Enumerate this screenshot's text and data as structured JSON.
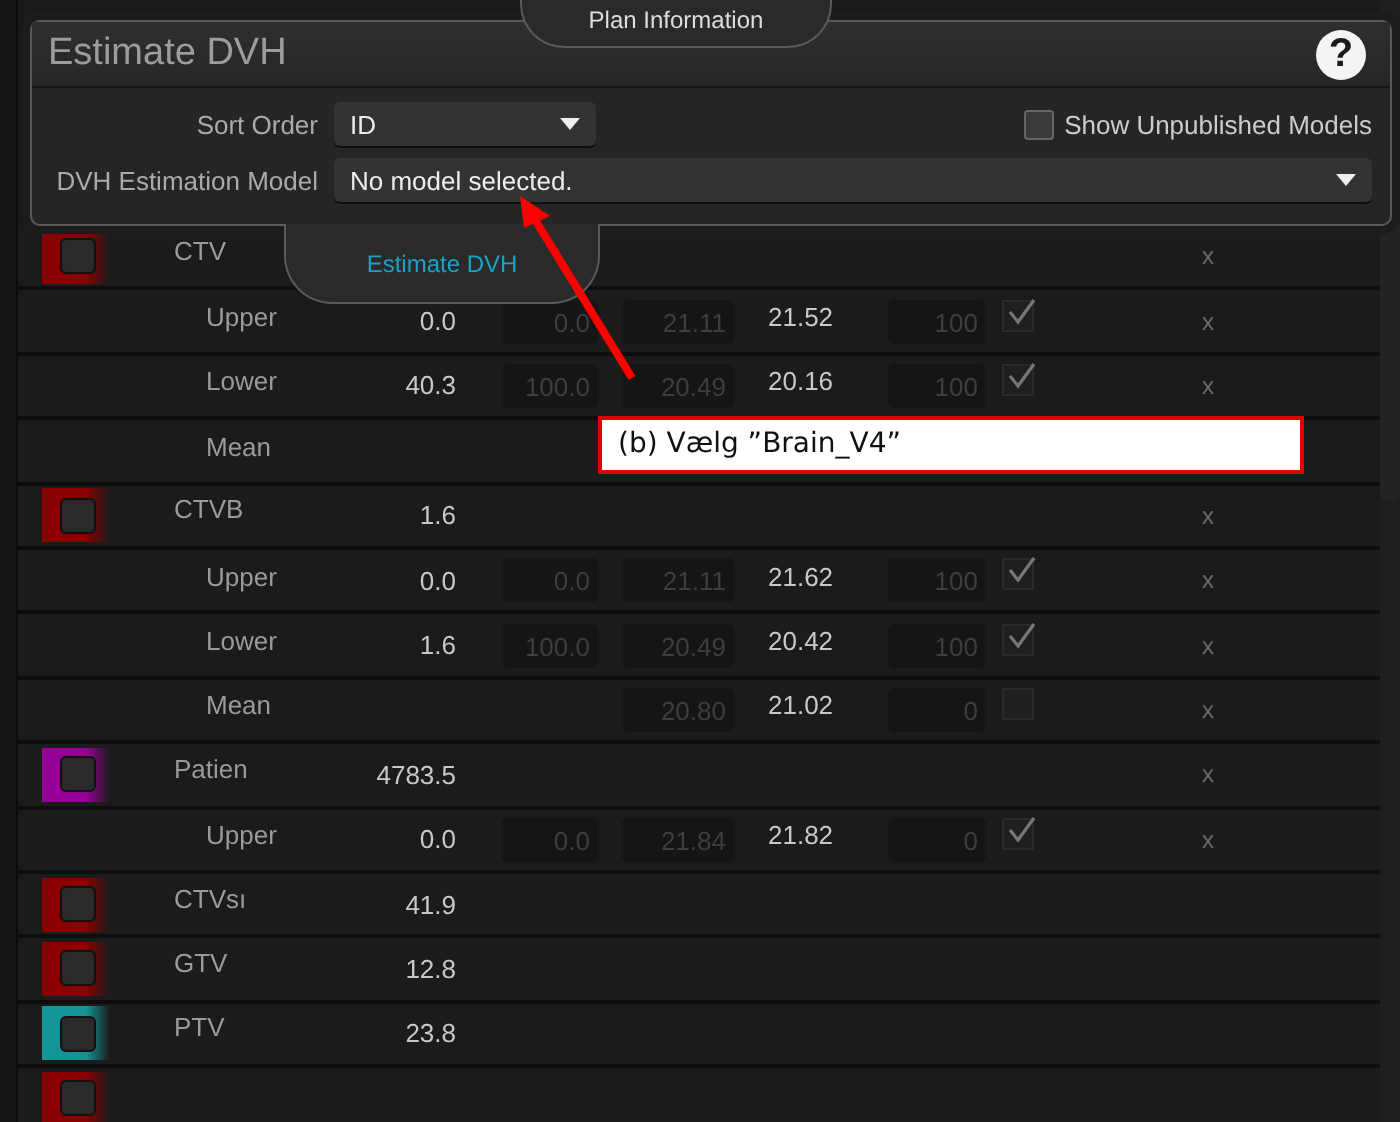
{
  "tabs": [
    {
      "label": "Plan Information",
      "selected": false
    },
    {
      "label": "Estimate DVH",
      "selected": true
    }
  ],
  "panel": {
    "title": "Estimate DVH",
    "help": "?",
    "sort_order": {
      "label": "Sort Order",
      "value": "ID"
    },
    "show_unpublished": {
      "label": "Show Unpublished Models",
      "checked": false
    },
    "model": {
      "label": "DVH Estimation Model",
      "value": "No model selected."
    }
  },
  "rows": [
    {
      "kind": "structure",
      "color": "#8a0000",
      "name": "CTV",
      "remove": "x"
    },
    {
      "kind": "objective",
      "label": "Upper",
      "value": "0.0",
      "volume_field": "0.0",
      "dose_field": "21.11",
      "dose": "21.52",
      "priority_field": "100",
      "checked": true,
      "remove": "x"
    },
    {
      "kind": "objective",
      "label": "Lower",
      "value": "40.3",
      "volume_field": "100.0",
      "dose_field": "20.49",
      "dose": "20.16",
      "priority_field": "100",
      "checked": true,
      "remove": "x"
    },
    {
      "kind": "objective",
      "label": "Mean"
    },
    {
      "kind": "structure",
      "color": "#8a0000",
      "name": "CTVB",
      "value": "1.6",
      "remove": "x"
    },
    {
      "kind": "objective",
      "label": "Upper",
      "value": "0.0",
      "volume_field": "0.0",
      "dose_field": "21.11",
      "dose": "21.62",
      "priority_field": "100",
      "checked": true,
      "remove": "x"
    },
    {
      "kind": "objective",
      "label": "Lower",
      "value": "1.6",
      "volume_field": "100.0",
      "dose_field": "20.49",
      "dose": "20.42",
      "priority_field": "100",
      "checked": true,
      "remove": "x"
    },
    {
      "kind": "objective",
      "label": "Mean",
      "dose_field": "20.80",
      "dose": "21.02",
      "priority_field": "0",
      "checked": false,
      "remove": "x"
    },
    {
      "kind": "structure",
      "color": "#960096",
      "name": "Patien",
      "value": "4783.5",
      "remove": "x"
    },
    {
      "kind": "objective",
      "label": "Upper",
      "value": "0.0",
      "volume_field": "0.0",
      "dose_field": "21.84",
      "dose": "21.82",
      "priority_field": "0",
      "checked": true,
      "remove": "x"
    },
    {
      "kind": "structure",
      "color": "#8a0000",
      "name": "CTVsı",
      "value": "41.9"
    },
    {
      "kind": "structure",
      "color": "#8a0000",
      "name": "GTV",
      "value": "12.8"
    },
    {
      "kind": "structure",
      "color": "#149494",
      "name": "PTV",
      "value": "23.8"
    },
    {
      "kind": "structure",
      "color": "#8a0000"
    }
  ],
  "callout": {
    "text": "(b) Vælg ”Brain_V4”"
  }
}
